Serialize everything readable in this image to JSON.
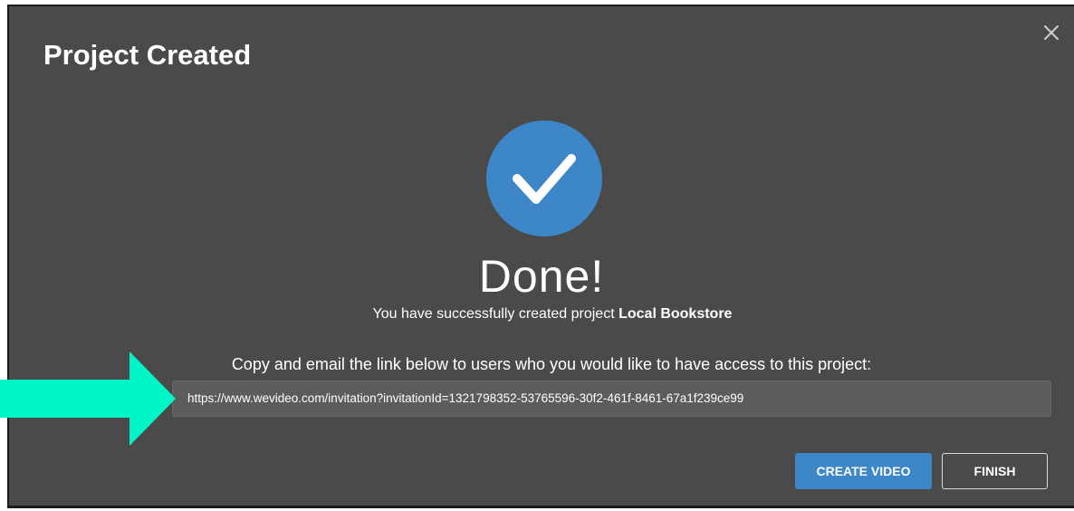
{
  "dialog": {
    "title": "Project Created",
    "close_icon": "close-icon"
  },
  "status": {
    "icon": "checkmark-circle-icon",
    "heading": "Done!",
    "message_prefix": "You have successfully created project ",
    "project_name": "Local Bookstore"
  },
  "share": {
    "instruction": "Copy and email the link below to users who you would like to have access to this project:",
    "link": "https://www.wevideo.com/invitation?invitationId=1321798352-53765596-30f2-461f-8461-67a1f239ce99"
  },
  "buttons": {
    "create_video": "CREATE VIDEO",
    "finish": "FINISH"
  },
  "annotation": {
    "icon": "arrow-right-icon"
  },
  "colors": {
    "dialog_bg": "#4a4a4a",
    "accent_blue": "#3d86c8",
    "arrow_teal": "#00f5c8",
    "link_field_bg": "#5c5c5c"
  }
}
